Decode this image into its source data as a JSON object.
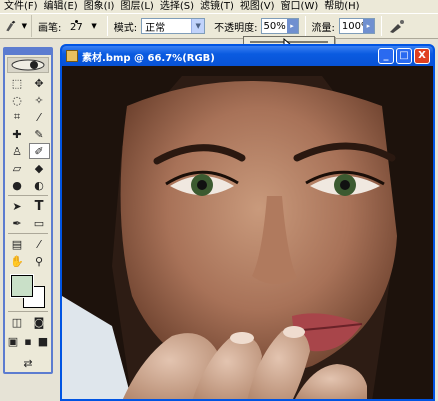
{
  "menu": {
    "items": [
      "文件(F)",
      "编辑(E)",
      "图象(I)",
      "图层(L)",
      "选择(S)",
      "滤镜(T)",
      "视图(V)",
      "窗口(W)",
      "帮助(H)"
    ]
  },
  "options": {
    "brush_label": "画笔:",
    "brush_size": "27",
    "mode_label": "模式:",
    "mode_value": "正常",
    "opacity_label": "不透明度:",
    "opacity_value": "50%",
    "flow_label": "流量:",
    "flow_value": "100%"
  },
  "document": {
    "title": "素材.bmp @ 66.7%(RGB)",
    "min_label": "_",
    "max_label": "□",
    "close_label": "X"
  },
  "colors": {
    "foreground": "#c9e0c8",
    "background": "#ffffff",
    "titlebar": "#0a5be0"
  },
  "opacity_slider": {
    "level": 0.5
  }
}
